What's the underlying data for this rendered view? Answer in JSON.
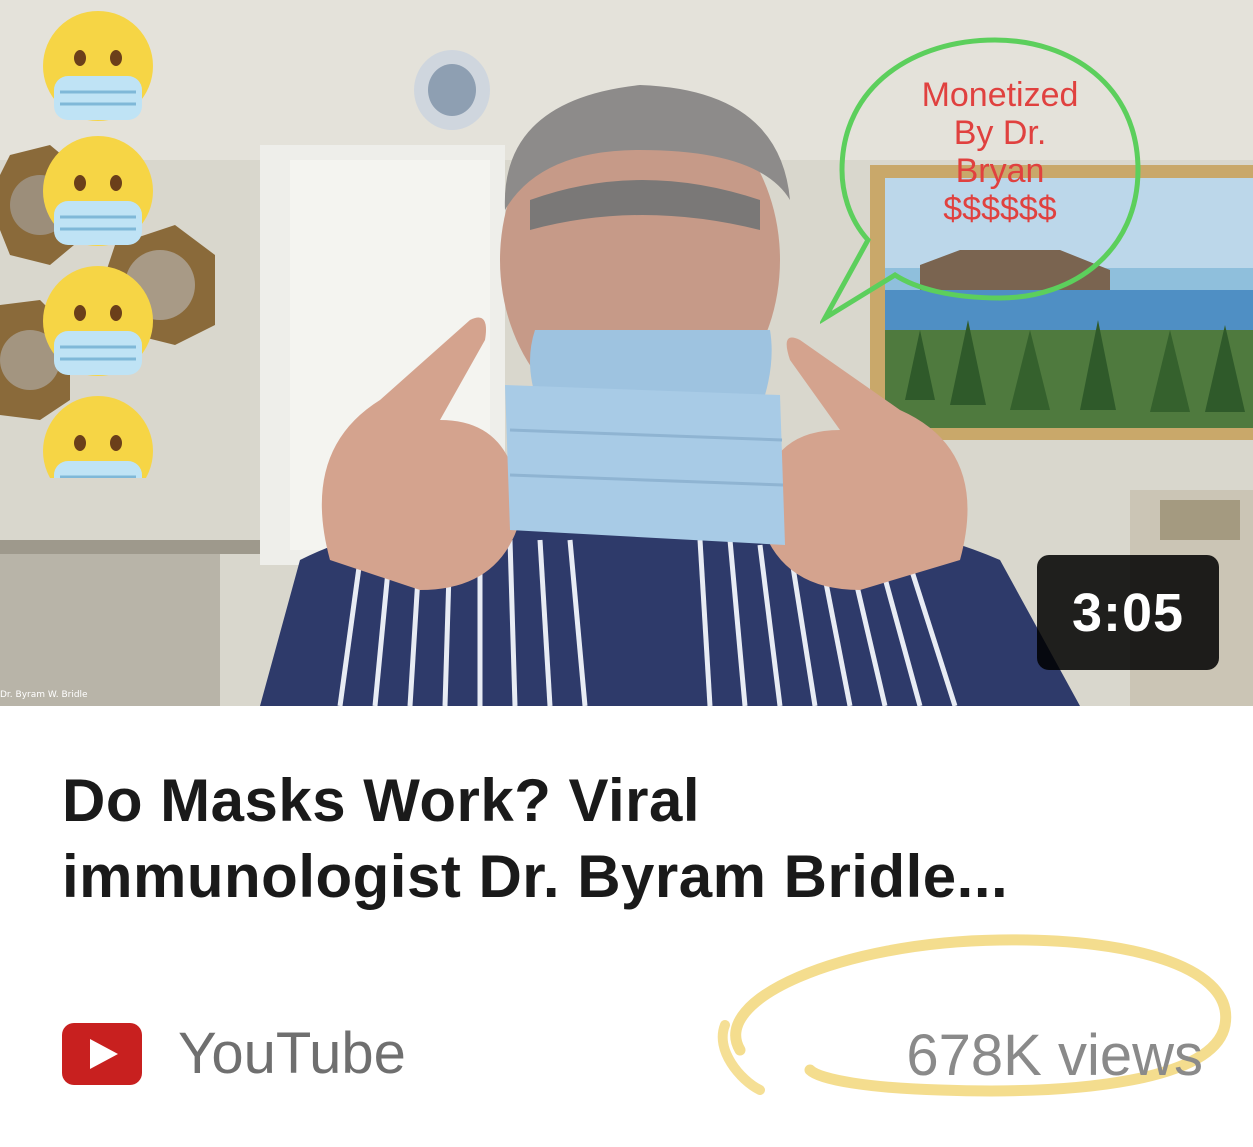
{
  "video": {
    "duration": "3:05",
    "overlay_caption": "Dr. Byram W. Bridle",
    "speech_bubble": {
      "line1": "Monetized",
      "line2": "By Dr.",
      "line3": "Bryan",
      "line4": "$$$$$$"
    },
    "emoji_icons": [
      "mask-emoji-icon",
      "mask-emoji-icon",
      "mask-emoji-icon",
      "mask-emoji-icon"
    ]
  },
  "card": {
    "title_line1": "Do Masks Work? Viral",
    "title_line2": "immunologist Dr. Byram Bridle...",
    "source_name": "YouTube",
    "source_icon": "youtube-logo-icon",
    "views": "678K views"
  },
  "colors": {
    "bubble_outline": "#5ccf5c",
    "bubble_text": "#e0413f",
    "highlight": "#f2d77a",
    "youtube_red": "#c8201f"
  }
}
